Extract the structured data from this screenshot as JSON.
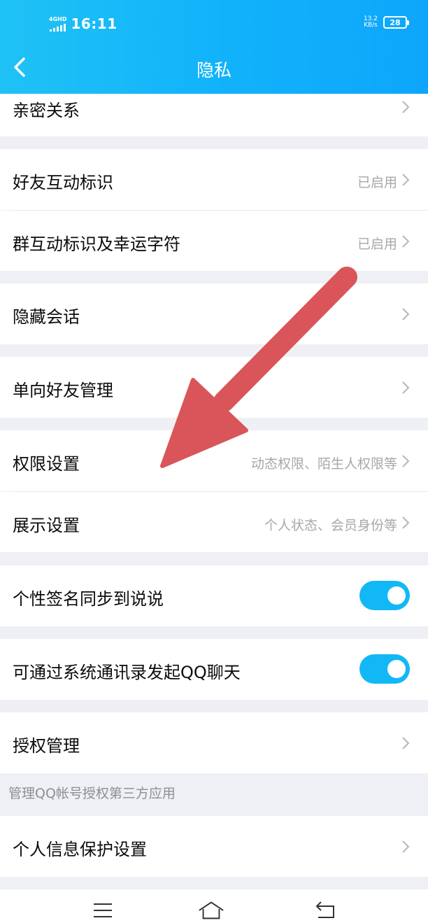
{
  "status_bar": {
    "network": "4GHD",
    "time": "16:11",
    "speed_value": "13.2",
    "speed_unit": "KB/s",
    "battery": "28"
  },
  "nav": {
    "title": "隐私"
  },
  "rows": {
    "intimate_relation": {
      "label": "亲密关系"
    },
    "friend_interaction": {
      "label": "好友互动标识",
      "value": "已启用"
    },
    "group_interaction": {
      "label": "群互动标识及幸运字符",
      "value": "已启用"
    },
    "hidden_chat": {
      "label": "隐藏会话"
    },
    "one_way_friend": {
      "label": "单向好友管理"
    },
    "permission_settings": {
      "label": "权限设置",
      "value": "动态权限、陌生人权限等"
    },
    "display_settings": {
      "label": "展示设置",
      "value": "个人状态、会员身份等"
    },
    "signature_sync": {
      "label": "个性签名同步到说说",
      "toggle": true
    },
    "contacts_chat": {
      "label": "可通过系统通讯录发起QQ聊天",
      "toggle": true
    },
    "authorization": {
      "label": "授权管理"
    },
    "personal_info": {
      "label": "个人信息保护设置"
    }
  },
  "authorization_note": "管理QQ帐号授权第三方应用",
  "colors": {
    "header_start": "#1fc2f5",
    "header_end": "#0ea6fb",
    "toggle_on": "#11b8f5",
    "annotation_arrow": "#d9555a",
    "page_background": "#eff0f5"
  },
  "icons": {
    "back": "chevron-left-icon",
    "row_chevron": "chevron-right-icon",
    "menu": "menu-icon",
    "home": "home-icon",
    "return": "return-icon"
  }
}
